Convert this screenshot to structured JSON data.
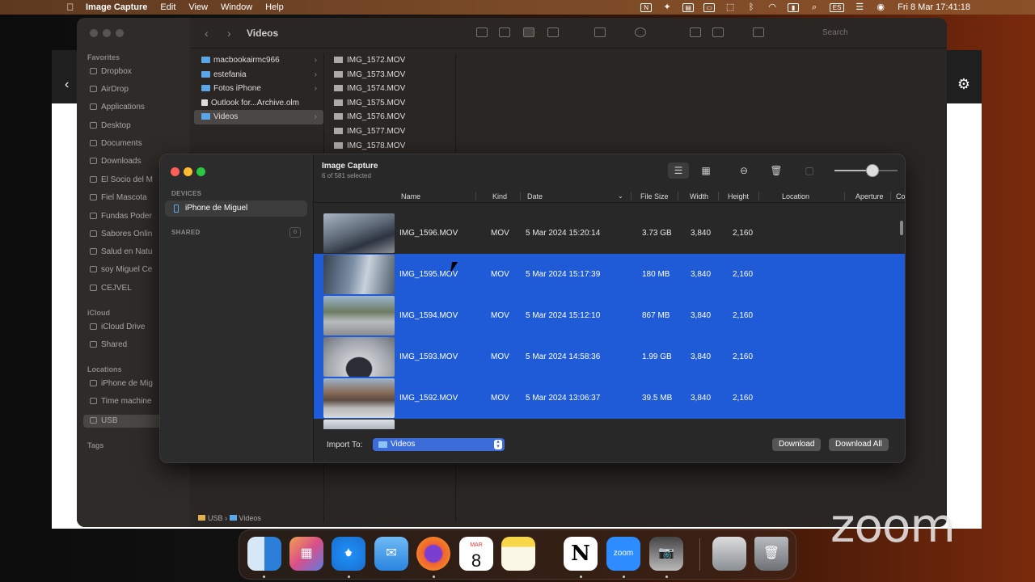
{
  "menubar": {
    "app": "Image Capture",
    "menus": [
      "Edit",
      "View",
      "Window",
      "Help"
    ],
    "input_source": "ES",
    "clock": "Fri 8 Mar  17:41:18"
  },
  "finder": {
    "title": "Videos",
    "search_placeholder": "Search",
    "sidebar": {
      "favorites_header": "Favorites",
      "favorites": [
        "Dropbox",
        "AirDrop",
        "Applications",
        "Desktop",
        "Documents",
        "Downloads",
        "El Socio del M",
        "Fiel Mascota",
        "Fundas Poder",
        "Sabores Onlin",
        "Salud en Natu",
        "soy Miguel Ce",
        "CEJVEL"
      ],
      "icloud_header": "iCloud",
      "icloud": [
        "iCloud Drive",
        "Shared"
      ],
      "locations_header": "Locations",
      "locations": [
        "iPhone de Mig",
        "Time machine",
        "USB"
      ],
      "tags_header": "Tags"
    },
    "column1": [
      "macbookairmc966",
      "estefania",
      "Fotos iPhone",
      "Outlook for...Archive.olm",
      "Videos"
    ],
    "column2": [
      "IMG_1572.MOV",
      "IMG_1573.MOV",
      "IMG_1574.MOV",
      "IMG_1575.MOV",
      "IMG_1576.MOV",
      "IMG_1577.MOV",
      "IMG_1578.MOV"
    ],
    "path": [
      "USB",
      "Videos"
    ]
  },
  "image_capture": {
    "title": "Image Capture",
    "subtitle": "6 of 581 selected",
    "devices_header": "DEVICES",
    "device": "iPhone de Miguel",
    "shared_header": "SHARED",
    "shared_count": "0",
    "zoom_slider_percent": 60,
    "columns": [
      "Name",
      "Kind",
      "Date",
      "File Size",
      "Width",
      "Height",
      "Location",
      "Aperture",
      "Co"
    ],
    "rows": [
      {
        "name": "IMG_1596.MOV",
        "kind": "MOV",
        "date": "5 Mar 2024 15:20:14",
        "size": "3.73 GB",
        "width": "3,840",
        "height": "2,160",
        "selected": false
      },
      {
        "name": "IMG_1595.MOV",
        "kind": "MOV",
        "date": "5 Mar 2024 15:17:39",
        "size": "180 MB",
        "width": "3,840",
        "height": "2,160",
        "selected": true
      },
      {
        "name": "IMG_1594.MOV",
        "kind": "MOV",
        "date": "5 Mar 2024 15:12:10",
        "size": "867 MB",
        "width": "3,840",
        "height": "2,160",
        "selected": true
      },
      {
        "name": "IMG_1593.MOV",
        "kind": "MOV",
        "date": "5 Mar 2024 14:58:36",
        "size": "1.99 GB",
        "width": "3,840",
        "height": "2,160",
        "selected": true
      },
      {
        "name": "IMG_1592.MOV",
        "kind": "MOV",
        "date": "5 Mar 2024 13:06:37",
        "size": "39.5 MB",
        "width": "3,840",
        "height": "2,160",
        "selected": true
      }
    ],
    "import_to_label": "Import To:",
    "import_to_value": "Videos",
    "download_label": "Download",
    "download_all_label": "Download All"
  },
  "backdoc": {
    "chevron": "‹",
    "gear": "⚙"
  },
  "dock": {
    "calendar_month": "MAR",
    "calendar_day": "8",
    "zoom_label": "zoom",
    "notion_label": "N"
  },
  "watermark": "zoom",
  "colors": {
    "selection": "#1f5bd6",
    "folder": "#5aa6e6"
  }
}
